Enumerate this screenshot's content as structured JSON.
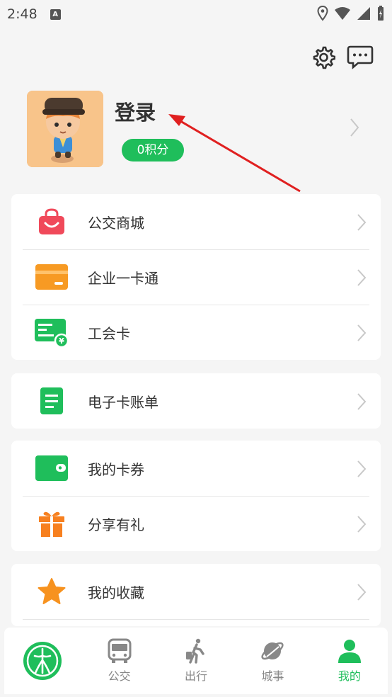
{
  "status_bar": {
    "time": "2:48",
    "app_icon": "A"
  },
  "header": {
    "settings_icon": "gear-icon",
    "message_icon": "chat-bubble-icon"
  },
  "profile": {
    "login_label": "登录",
    "points_label": "0积分"
  },
  "menu_groups": [
    {
      "items": [
        {
          "label": "公交商城",
          "icon": "shopping-bag-icon"
        },
        {
          "label": "企业一卡通",
          "icon": "card-icon"
        },
        {
          "label": "工会卡",
          "icon": "union-card-icon"
        }
      ]
    },
    {
      "items": [
        {
          "label": "电子卡账单",
          "icon": "bill-icon"
        }
      ]
    },
    {
      "items": [
        {
          "label": "我的卡券",
          "icon": "wallet-icon"
        },
        {
          "label": "分享有礼",
          "icon": "gift-icon"
        }
      ]
    },
    {
      "items": [
        {
          "label": "我的收藏",
          "icon": "star-icon"
        }
      ]
    }
  ],
  "tabbar": {
    "tabs": [
      {
        "label": "",
        "icon": "app-logo-icon"
      },
      {
        "label": "公交",
        "icon": "bus-icon"
      },
      {
        "label": "出行",
        "icon": "walking-icon"
      },
      {
        "label": "城事",
        "icon": "planet-icon"
      },
      {
        "label": "我的",
        "icon": "person-icon",
        "active": true
      }
    ]
  },
  "colors": {
    "accent": "#1fbe5b",
    "annotation_arrow": "#e02020"
  }
}
